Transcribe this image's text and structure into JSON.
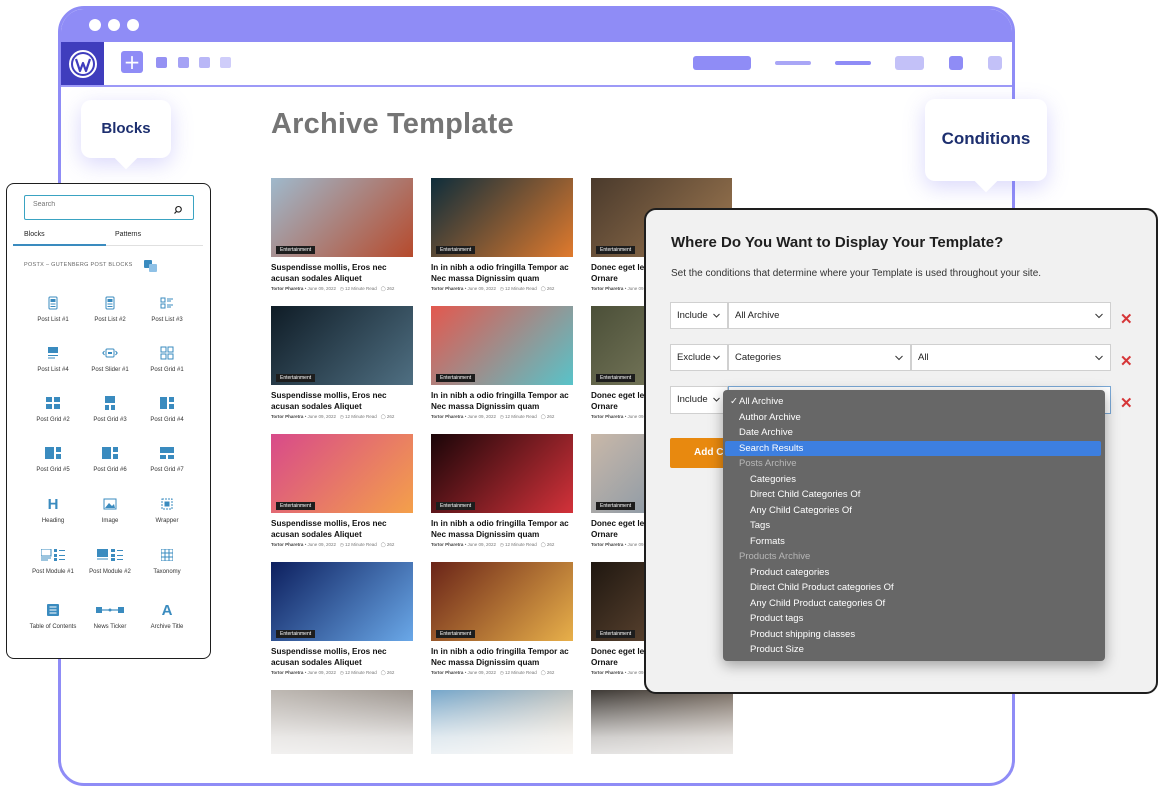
{
  "page": {
    "title": "Archive Template"
  },
  "callouts": {
    "blocks": "Blocks",
    "conditions": "Conditions"
  },
  "posts": [
    {
      "title": "Suspendisse mollis, Eros nec acusan sodales Aliquet",
      "badge": "Entertainment",
      "author": "Tortor Pharetra",
      "date": "June 09, 2022",
      "read": "12 Minute Read",
      "comments": "262",
      "colors": [
        "#9fb9cc",
        "#b64a2c"
      ]
    },
    {
      "title": "In in nibh a odio fringilla Tempor ac Nec massa Dignissim quam",
      "badge": "Entertainment",
      "author": "Tortor Pharetra",
      "date": "June 09, 2022",
      "read": "12 Minute Read",
      "comments": "262",
      "colors": [
        "#0e2d3b",
        "#e07a2d"
      ]
    },
    {
      "title": "Donec eget leo ac sem Finibus Ornare",
      "badge": "Entertainment",
      "author": "Tortor Pharetra",
      "date": "June 09, 2022",
      "read": "12 Minute Read",
      "comments": "262",
      "colors": [
        "#4a3a2c",
        "#a07a52"
      ]
    },
    {
      "title": "Suspendisse mollis, Eros nec acusan sodales Aliquet",
      "badge": "Entertainment",
      "author": "Tortor Pharetra",
      "date": "June 09, 2022",
      "read": "12 Minute Read",
      "comments": "262",
      "colors": [
        "#0f1c26",
        "#4f6f82"
      ]
    },
    {
      "title": "In in nibh a odio fringilla Tempor ac Nec massa Dignissim quam",
      "badge": "Entertainment",
      "author": "Tortor Pharetra",
      "date": "June 09, 2022",
      "read": "12 Minute Read",
      "comments": "262",
      "colors": [
        "#e3584e",
        "#58c3c9"
      ]
    },
    {
      "title": "Donec eget leo ac sem Finibus Ornare",
      "badge": "Entertainment",
      "author": "Tortor Pharetra",
      "date": "June 09, 2022",
      "read": "12 Minute Read",
      "comments": "262",
      "colors": [
        "#4b4f38",
        "#8a8a6a"
      ]
    },
    {
      "title": "Suspendisse mollis, Eros nec acusan sodales Aliquet",
      "badge": "Entertainment",
      "author": "Tortor Pharetra",
      "date": "June 09, 2022",
      "read": "12 Minute Read",
      "comments": "262",
      "colors": [
        "#d84a8a",
        "#f4a04a"
      ]
    },
    {
      "title": "In in nibh a odio fringilla Tempor ac Nec massa Dignissim quam",
      "badge": "Entertainment",
      "author": "Tortor Pharetra",
      "date": "June 09, 2022",
      "read": "12 Minute Read",
      "comments": "262",
      "colors": [
        "#1a0508",
        "#d3323a"
      ]
    },
    {
      "title": "Donec eget leo ac sem Finibus Ornare",
      "badge": "Entertainment",
      "author": "Tortor Pharetra",
      "date": "June 09, 2022",
      "read": "12 Minute Read",
      "comments": "262",
      "colors": [
        "#c9b8a8",
        "#6d8aa6"
      ]
    },
    {
      "title": "Suspendisse mollis, Eros nec acusan sodales Aliquet",
      "badge": "Entertainment",
      "author": "Tortor Pharetra",
      "date": "June 09, 2022",
      "read": "12 Minute Read",
      "comments": "262",
      "colors": [
        "#0d1f5e",
        "#6aa8e8"
      ]
    },
    {
      "title": "In in nibh a odio fringilla Tempor ac Nec massa Dignissim quam",
      "badge": "Entertainment",
      "author": "Tortor Pharetra",
      "date": "June 09, 2022",
      "read": "12 Minute Read",
      "comments": "262",
      "colors": [
        "#6a2418",
        "#e8b04a"
      ]
    },
    {
      "title": "Donec eget leo ac sem Finibus Ornare",
      "badge": "Entertainment",
      "author": "Tortor Pharetra",
      "date": "June 09, 2022",
      "read": "12 Minute Read",
      "comments": "262",
      "colors": [
        "#1f1710",
        "#7a5a40"
      ]
    }
  ],
  "faded_posts": [
    {
      "colors": [
        "#b9b3ad",
        "#8a817a"
      ]
    },
    {
      "colors": [
        "#6aa0c8",
        "#d8c8b4"
      ]
    },
    {
      "colors": [
        "#2e2a26",
        "#8a7a6c"
      ]
    }
  ],
  "blocks_panel": {
    "search_placeholder": "Search",
    "tab_blocks": "Blocks",
    "tab_patterns": "Patterns",
    "section_label": "POSTX – GUTENBERG POST BLOCKS",
    "items": [
      {
        "label": "Post List #1",
        "icon": "post-list-1-icon"
      },
      {
        "label": "Post List #2",
        "icon": "post-list-2-icon"
      },
      {
        "label": "Post List #3",
        "icon": "post-list-3-icon"
      },
      {
        "label": "Post List #4",
        "icon": "post-list-4-icon"
      },
      {
        "label": "Post Slider #1",
        "icon": "post-slider-icon"
      },
      {
        "label": "Post Grid #1",
        "icon": "post-grid-1-icon"
      },
      {
        "label": "Post Grid #2",
        "icon": "post-grid-2-icon"
      },
      {
        "label": "Post Grid #3",
        "icon": "post-grid-3-icon"
      },
      {
        "label": "Post Grid #4",
        "icon": "post-grid-4-icon"
      },
      {
        "label": "Post Grid #5",
        "icon": "post-grid-5-icon"
      },
      {
        "label": "Post Grid #6",
        "icon": "post-grid-6-icon"
      },
      {
        "label": "Post Grid #7",
        "icon": "post-grid-7-icon"
      },
      {
        "label": "Heading",
        "icon": "heading-icon"
      },
      {
        "label": "Image",
        "icon": "image-icon"
      },
      {
        "label": "Wrapper",
        "icon": "wrapper-icon"
      },
      {
        "label": "Post Module #1",
        "icon": "post-module-1-icon"
      },
      {
        "label": "Post Module #2",
        "icon": "post-module-2-icon"
      },
      {
        "label": "Taxonomy",
        "icon": "taxonomy-icon"
      },
      {
        "label": "Table of Contents",
        "icon": "table-of-contents-icon"
      },
      {
        "label": "News Ticker",
        "icon": "news-ticker-icon"
      },
      {
        "label": "Archive Title",
        "icon": "archive-title-icon"
      }
    ]
  },
  "conditions": {
    "title": "Where Do You Want to Display Your Template?",
    "description": "Set the conditions that determine where your Template is used throughout your site.",
    "rows": [
      {
        "type": "Include",
        "value": "All Archive"
      },
      {
        "type": "Exclude",
        "value": "Categories",
        "sub": "All"
      },
      {
        "type": "Include"
      }
    ],
    "add_label": "Add C",
    "delete_symbol": "✕",
    "dropdown": {
      "check": "✓",
      "selected": "Search Results",
      "options": [
        {
          "label": "All Archive",
          "level": 0,
          "checked": true
        },
        {
          "label": "Author Archive",
          "level": 0
        },
        {
          "label": "Date Archive",
          "level": 0
        },
        {
          "label": "Search Results",
          "level": 0
        },
        {
          "label": "Posts Archive",
          "level": 0,
          "group": true
        },
        {
          "label": "Categories",
          "level": 1
        },
        {
          "label": "Direct Child Categories Of",
          "level": 1
        },
        {
          "label": "Any Child Categories Of",
          "level": 1
        },
        {
          "label": "Tags",
          "level": 1
        },
        {
          "label": "Formats",
          "level": 1
        },
        {
          "label": "Products Archive",
          "level": 0,
          "group": true
        },
        {
          "label": "Product categories",
          "level": 1
        },
        {
          "label": "Direct Child Product categories Of",
          "level": 1
        },
        {
          "label": "Any Child Product categories Of",
          "level": 1
        },
        {
          "label": "Product tags",
          "level": 1
        },
        {
          "label": "Product shipping classes",
          "level": 1
        },
        {
          "label": "Product Size",
          "level": 1
        }
      ]
    }
  },
  "colors": {
    "frame": "#8f8cf6",
    "wp_logo_bg": "#3f3dbd",
    "accent_blue": "#3a8bbf",
    "add_button": "#e8890f",
    "delete": "#d63638",
    "dropdown_bg": "#676767",
    "dropdown_selected": "#3d7fe0"
  }
}
